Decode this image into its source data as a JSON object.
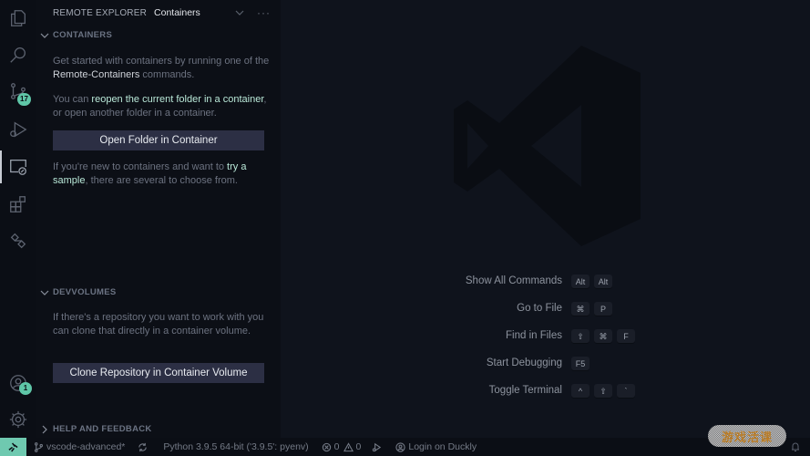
{
  "activity_bar": {
    "items": [
      {
        "name": "explorer",
        "icon": "files-icon"
      },
      {
        "name": "search",
        "icon": "search-icon"
      },
      {
        "name": "source-control",
        "icon": "source-control-icon",
        "badge": "17"
      },
      {
        "name": "run-debug",
        "icon": "run-debug-icon"
      },
      {
        "name": "remote-explorer",
        "icon": "remote-explorer-icon",
        "active": true
      },
      {
        "name": "extensions",
        "icon": "extensions-icon"
      },
      {
        "name": "live-share",
        "icon": "live-share-icon"
      }
    ],
    "bottom": [
      {
        "name": "accounts",
        "icon": "account-icon",
        "badge": "1"
      },
      {
        "name": "manage",
        "icon": "gear-icon"
      }
    ]
  },
  "sidebar": {
    "title": "REMOTE EXPLORER",
    "selected_view": "Containers",
    "more": "···",
    "sections": {
      "containers": {
        "title": "CONTAINERS",
        "p1_pre": "Get started with containers by running one of the ",
        "p1_link": "Remote-Containers",
        "p1_post": " commands.",
        "p2_pre": "You can ",
        "p2_link": "reopen the current folder in a container",
        "p2_post": ", or open another folder in a container.",
        "button": "Open Folder in Container",
        "p3_pre": "If you're new to containers and want to ",
        "p3_link": "try a sample",
        "p3_post": ", there are several to choose from."
      },
      "devvolumes": {
        "title": "DEVVOLUMES",
        "p1": "If there's a repository you want to work with you can clone that directly in a container volume.",
        "button": "Clone Repository in Container Volume"
      },
      "help": {
        "title": "HELP AND FEEDBACK"
      }
    }
  },
  "editor": {
    "shortcuts": [
      {
        "label": "Show All Commands",
        "keys": [
          "Alt",
          "Alt"
        ]
      },
      {
        "label": "Go to File",
        "keys": [
          "⌘",
          "P"
        ]
      },
      {
        "label": "Find in Files",
        "keys": [
          "⇧",
          "⌘",
          "F"
        ]
      },
      {
        "label": "Start Debugging",
        "keys": [
          "F5"
        ]
      },
      {
        "label": "Toggle Terminal",
        "keys": [
          "^",
          "⇧",
          "`"
        ]
      }
    ]
  },
  "statusbar": {
    "branch": "vscode-advanced*",
    "python": "Python 3.9.5 64-bit ('3.9.5': pyenv)",
    "errors": "0",
    "warnings": "0",
    "login": "Login on Duckly",
    "watermark": "游戏活课"
  },
  "colors": {
    "accent": "#6fc9b0",
    "badge": "#5fc7a8",
    "button_bg": "#2c2f44",
    "link": "#b9e8d8"
  }
}
